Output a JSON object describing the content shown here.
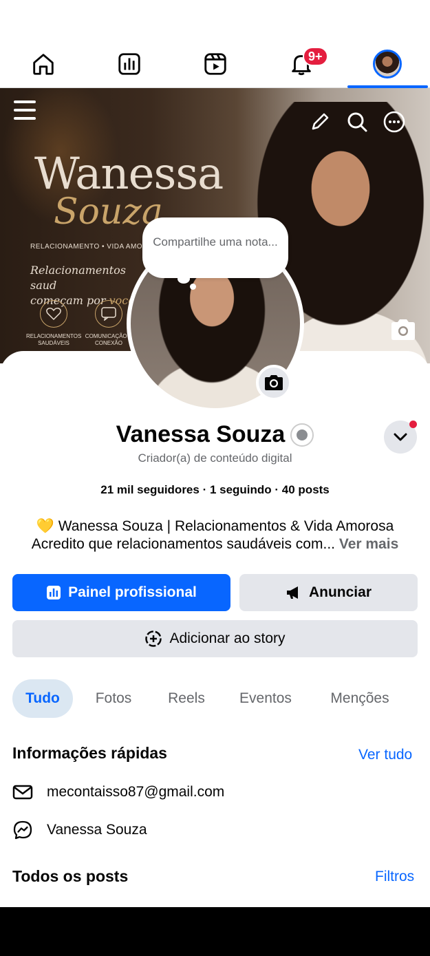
{
  "nav": {
    "badge": "9+"
  },
  "cover": {
    "title": "Wanessa",
    "script": "Souza",
    "subtitle": "RELACIONAMENTO • VIDA AMOROSA",
    "tagline_a": "Relacionamentos saud",
    "tagline_b": "começam por ",
    "tagline_c": "você",
    "tagline_d": ".",
    "feature1": "RELACIONAMENTOS SAUDÁVEIS",
    "feature2": "COMUNICAÇÃO E CONEXÃO"
  },
  "note": {
    "text": "Compartilhe uma nota..."
  },
  "profile": {
    "name": "Vanessa Souza",
    "subtitle": "Criador(a) de conteúdo digital",
    "stats": "21 mil seguidores · 1 seguindo · 40 posts",
    "bio_line1": "💛 Wanessa Souza | Relacionamentos & Vida Amorosa",
    "bio_line2": "Acredito que relacionamentos saudáveis com...",
    "bio_more": "Ver mais"
  },
  "buttons": {
    "dashboard": "Painel profissional",
    "advertise": "Anunciar",
    "add_story": "Adicionar ao story"
  },
  "tabs": [
    {
      "label": "Tudo"
    },
    {
      "label": "Fotos"
    },
    {
      "label": "Reels"
    },
    {
      "label": "Eventos"
    },
    {
      "label": "Menções"
    }
  ],
  "quick_info": {
    "title": "Informações rápidas",
    "link": "Ver tudo",
    "email": "mecontaisso87@gmail.com",
    "messenger": "Vanessa Souza"
  },
  "posts": {
    "title": "Todos os posts",
    "link": "Filtros"
  },
  "colors": {
    "accent": "#0866ff",
    "badge": "#e41e3f",
    "secondary_button": "#e4e6eb"
  }
}
